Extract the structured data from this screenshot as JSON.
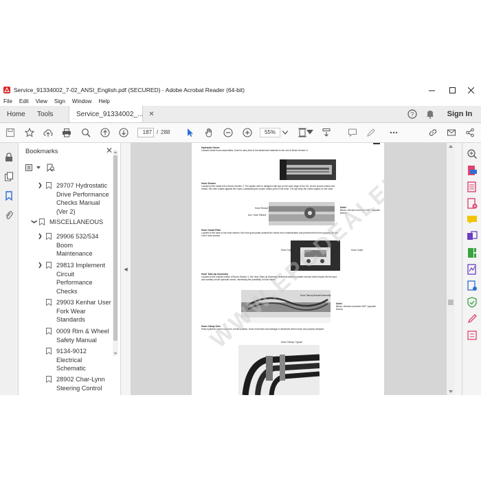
{
  "window": {
    "title": "Service_91334002_7-02_ANSI_English.pdf (SECURED) - Adobe Acrobat Reader (64-bit)"
  },
  "menu": [
    "File",
    "Edit",
    "View",
    "Sign",
    "Window",
    "Help"
  ],
  "tabs": {
    "home": "Home",
    "tools": "Tools",
    "document": "Service_91334002_...",
    "sign_in": "Sign In"
  },
  "toolbar": {
    "current_page": "187",
    "page_separator": "/",
    "total_pages": "288",
    "zoom": "55%"
  },
  "bookmarks": {
    "header": "Bookmarks",
    "items": [
      {
        "label": "29707 Hydrostatic Drive Performance Checks Manual (Ver 2)",
        "lines": [
          "29707 Hydrostatic",
          "Drive Performance",
          "Checks Manual",
          "(Ver 2)"
        ],
        "level": 1,
        "expand": "collapsed"
      },
      {
        "label": "MISCELLANEOUS",
        "lines": [
          "MISCELLANEOUS"
        ],
        "level": 0,
        "expand": "expanded"
      },
      {
        "label": "29906 532/534 Boom Maintenance",
        "lines": [
          "29906 532/534",
          "Boom",
          "Maintenance"
        ],
        "level": 1,
        "expand": "collapsed"
      },
      {
        "label": "29813 Implement Circuit Performance Checks",
        "lines": [
          "29813 Implement",
          "Circuit",
          "Performance",
          "Checks"
        ],
        "level": 1,
        "expand": "collapsed"
      },
      {
        "label": "29903 Kenhar User Fork Wear Standards",
        "lines": [
          "29903 Kenhar User",
          "Fork Wear",
          "Standards"
        ],
        "level": 1,
        "expand": "none"
      },
      {
        "label": "0009 Rim & Wheel Safety Manual",
        "lines": [
          "0009 Rim & Wheel",
          "Safety Manual"
        ],
        "level": 1,
        "expand": "none"
      },
      {
        "label": "9134-9012 Electrical Schematic",
        "lines": [
          "9134-9012",
          "Electrical",
          "Schematic"
        ],
        "level": 1,
        "expand": "none"
      },
      {
        "label": "28902 Char-Lynn Steering Control",
        "lines": [
          "28902 Char-Lynn",
          "Steering Control"
        ],
        "level": 1,
        "expand": "none"
      }
    ]
  },
  "document_page": {
    "sections": [
      {
        "heading": "Hydraulic Hoses",
        "body": "Located inside boom assemblies. Used to carry fluid to the attachment fastened to the end of Boom-Section 3."
      },
      {
        "heading": "Hose Sheave",
        "body": "Located at the inside left of Boom-Section 2. The plastic roller is designed with lips on the outer edge of the OD. As the booms extend and retract, the roller rotates against the hoses, maintaining the proper radius point of the hose. The lips keep the hoses captive on the roller."
      },
      {
        "heading": "Hose Guard Plate",
        "body": "Located in the back of the hose sheave, the hose guard plate protects the hoses from contamination and prevents them from popping the lips of the hose sheave."
      },
      {
        "heading": "Hose Take-Up Assembly",
        "body": "Located at the outside bottom of Boom-Section 1, the Hose Take-Up Assembly weldment absorbs sudden shocks which impact the tilt cloud and auxiliary circuit hydraulic hoses, minimizing the possibility of hose failure."
      },
      {
        "heading": "Hose Clamp Sets",
        "body": "Keep hydraulic hoses located in a fixed position. Hose movement and damage is minimized when hoses are properly clamped."
      }
    ],
    "labels": {
      "hose_sheave": "Hose Sheave",
      "aux_hose_sheave": "Aux. Hose Sheave",
      "hose_guard_left": "Hose Guard",
      "hose_guard_right": "Hose Guard",
      "hose_takeup_bracket": "Hose Takeup Bracket Assembly",
      "hose_clamps": "Hose Clamps, Typical"
    },
    "notes": [
      {
        "title": "Note!",
        "text": "Boom-Section inverted 180° (upside-down)"
      },
      {
        "title": "Note!",
        "text": "Boom-Section inverted 180° (upside-down)"
      }
    ],
    "watermark": "WWW.EPCDEALER.COM"
  },
  "colors": {
    "accent_red": "#d7262a",
    "chrome_bg": "#f4f4f4",
    "doc_bg": "#d6d6d6",
    "blue_icon": "#2c6ed5",
    "pink_icon": "#e0436e"
  },
  "icons": {
    "right_rail": [
      "zoom-in-icon",
      "export-pdf-icon",
      "create-pdf-icon",
      "edit-pdf-icon",
      "comment-icon",
      "combine-files-icon",
      "organize-pages-icon",
      "fill-sign-icon",
      "send-for-review-icon",
      "protect-icon",
      "more-tools-icon"
    ]
  }
}
